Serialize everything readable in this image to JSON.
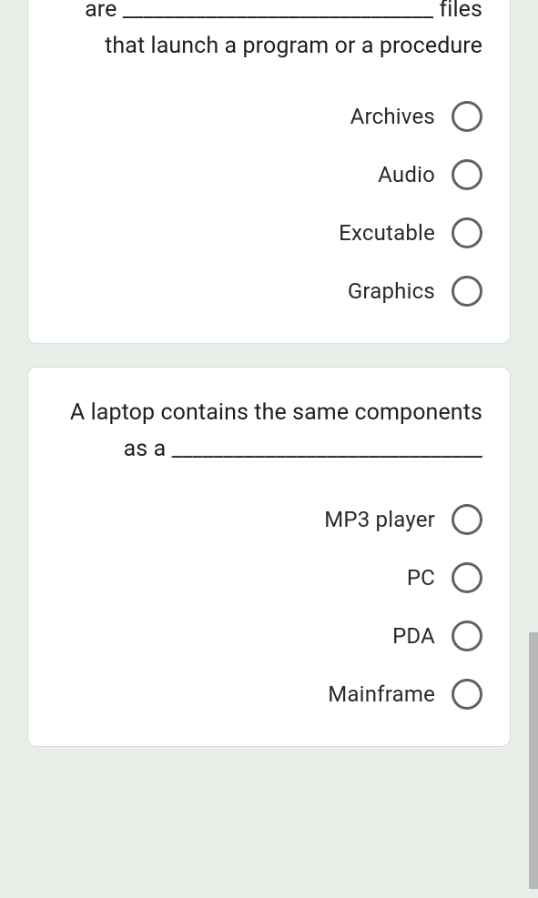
{
  "questions": [
    {
      "prompt": "are ______________________________ files that launch a program or a procedure",
      "options": [
        "Archives",
        "Audio",
        "Excutable",
        "Graphics"
      ]
    },
    {
      "prompt": "A laptop contains the same components as a ______________________________",
      "options": [
        "MP3 player",
        "PC",
        "PDA",
        "Mainframe"
      ]
    }
  ]
}
